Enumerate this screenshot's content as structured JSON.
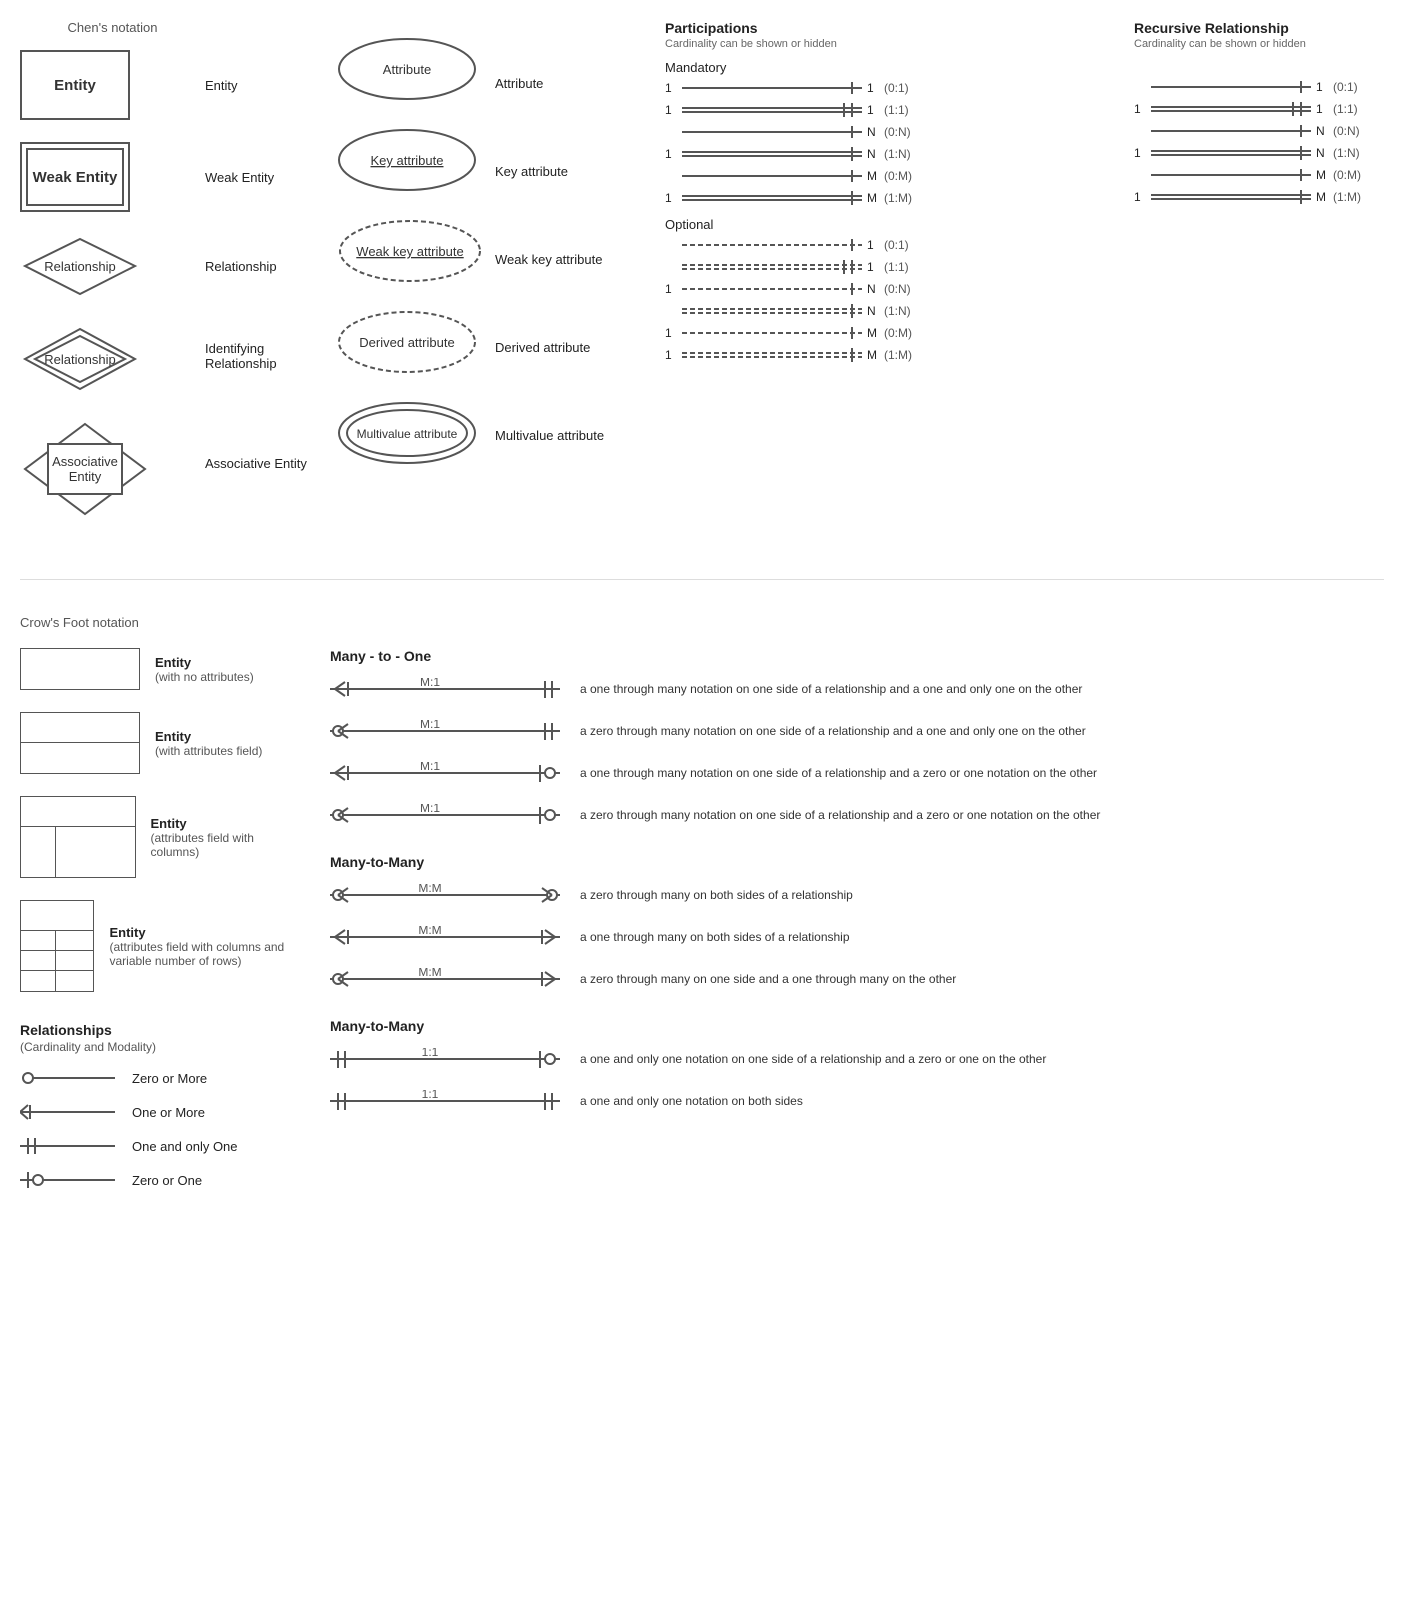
{
  "chens": {
    "header": "Chen's notation",
    "entities": [
      {
        "name": "entity",
        "shape": "rect",
        "shapeLabel": "Entity",
        "label": "Entity"
      },
      {
        "name": "weak-entity",
        "shape": "weak-rect",
        "shapeLabel": "Weak Entity",
        "label": "Weak Entity"
      },
      {
        "name": "relationship",
        "shape": "diamond",
        "shapeLabel": "Relationship",
        "label": "Relationship"
      },
      {
        "name": "identifying-relationship",
        "shape": "double-diamond",
        "shapeLabel": "Relationship",
        "label": "Identifying Relationship"
      },
      {
        "name": "associative-entity",
        "shape": "assoc",
        "shapeLabel": "Associative Entity",
        "label": "Associative Entity"
      }
    ],
    "attributes": [
      {
        "name": "attribute",
        "shape": "ellipse",
        "shapeLabel": "Attribute",
        "label": "Attribute"
      },
      {
        "name": "key-attribute",
        "shape": "ellipse-underline",
        "shapeLabel": "Key attribute",
        "label": "Key attribute"
      },
      {
        "name": "weak-key-attribute",
        "shape": "ellipse-dashed-underline",
        "shapeLabel": "Weak key attribute",
        "label": "Weak key attribute"
      },
      {
        "name": "derived-attribute",
        "shape": "ellipse-dashed",
        "shapeLabel": "Derived attribute",
        "label": "Derived attribute"
      },
      {
        "name": "multivalue-attribute",
        "shape": "ellipse-double",
        "shapeLabel": "Multivalue attribute",
        "label": "Multivalue attribute"
      }
    ]
  },
  "participations": {
    "header": "Participations",
    "sub": "Cardinality can be shown or hidden",
    "mandatory_label": "Mandatory",
    "optional_label": "Optional",
    "mandatory_rows": [
      {
        "left": "1",
        "right": "1",
        "notation": "(0:1)"
      },
      {
        "left": "1",
        "right": "1",
        "notation": "(1:1)"
      },
      {
        "left": "",
        "right": "N",
        "notation": "(0:N)"
      },
      {
        "left": "1",
        "right": "N",
        "notation": "(1:N)"
      },
      {
        "left": "",
        "right": "M",
        "notation": "(0:M)"
      },
      {
        "left": "1",
        "right": "M",
        "notation": "(1:M)"
      }
    ],
    "optional_rows": [
      {
        "left": "",
        "right": "1",
        "notation": "(0:1)"
      },
      {
        "left": "",
        "right": "1",
        "notation": "(1:1)"
      },
      {
        "left": "1",
        "right": "N",
        "notation": "(0:N)"
      },
      {
        "left": "",
        "right": "N",
        "notation": "(1:N)"
      },
      {
        "left": "1",
        "right": "M",
        "notation": "(0:M)"
      },
      {
        "left": "1",
        "right": "M",
        "notation": "(1:M)"
      }
    ]
  },
  "recursive": {
    "header": "Recursive Relationship",
    "sub": "Cardinality can be shown or hidden",
    "rows": [
      {
        "left": "",
        "right": "1",
        "notation": "(0:1)"
      },
      {
        "left": "1",
        "right": "1",
        "notation": "(1:1)"
      },
      {
        "left": "",
        "right": "N",
        "notation": "(0:N)"
      },
      {
        "left": "1",
        "right": "N",
        "notation": "(1:N)"
      },
      {
        "left": "",
        "right": "M",
        "notation": "(0:M)"
      },
      {
        "left": "1",
        "right": "M",
        "notation": "(1:M)"
      }
    ]
  },
  "crows": {
    "header": "Crow's Foot notation",
    "entities": [
      {
        "label": "Entity",
        "sublabel": "(with no attributes)",
        "type": "simple"
      },
      {
        "label": "Entity",
        "sublabel": "(with attributes field)",
        "type": "header-body"
      },
      {
        "label": "Entity",
        "sublabel": "(attributes field with columns)",
        "type": "columns"
      },
      {
        "label": "Entity",
        "sublabel": "(attributes field with columns and variable number of rows)",
        "type": "columns-rows"
      }
    ],
    "relationships_header": "Relationships",
    "relationships_sub": "(Cardinality and Modality)",
    "rel_symbols": [
      {
        "symbol": "zero-or-more",
        "label": "Zero or More"
      },
      {
        "symbol": "one-or-more",
        "label": "One or More"
      },
      {
        "symbol": "one-and-only-one",
        "label": "One and only One"
      },
      {
        "symbol": "zero-or-one",
        "label": "Zero or One"
      }
    ],
    "many_to_one_header": "Many - to - One",
    "many_to_one": [
      {
        "ratio": "M:1",
        "desc": "a one through many notation on one side of a relationship and a one and only one on the other",
        "left": "crow-one",
        "right": "one-only"
      },
      {
        "ratio": "M:1",
        "desc": "a zero through many notation on one side of a relationship and a one and only one on the other",
        "left": "crow-zero",
        "right": "one-only"
      },
      {
        "ratio": "M:1",
        "desc": "a one through many notation on one side of a relationship and a zero or one notation on the other",
        "left": "crow-one",
        "right": "zero-one"
      },
      {
        "ratio": "M:1",
        "desc": "a zero through many notation on one side of a relationship and a zero or one notation on the other",
        "left": "crow-zero",
        "right": "zero-one"
      }
    ],
    "many_to_many_header": "Many-to-Many",
    "many_to_many": [
      {
        "ratio": "M:M",
        "desc": "a zero through many on both sides of a relationship",
        "left": "crow-zero",
        "right": "crow-zero-r"
      },
      {
        "ratio": "M:M",
        "desc": "a one through many on both sides of a relationship",
        "left": "crow-one",
        "right": "crow-one-r"
      },
      {
        "ratio": "M:M",
        "desc": "a zero through many on one side and a one through many on the other",
        "left": "crow-zero",
        "right": "crow-one-r"
      }
    ],
    "many_to_many2_header": "Many-to-Many",
    "many_to_many2": [
      {
        "ratio": "1:1",
        "desc": "a one and only one notation on one side of a relationship and a zero or one on the other",
        "left": "one-only",
        "right": "zero-one-r"
      },
      {
        "ratio": "1:1",
        "desc": "a one and only one notation on both sides",
        "left": "one-only",
        "right": "one-only-r"
      }
    ]
  }
}
